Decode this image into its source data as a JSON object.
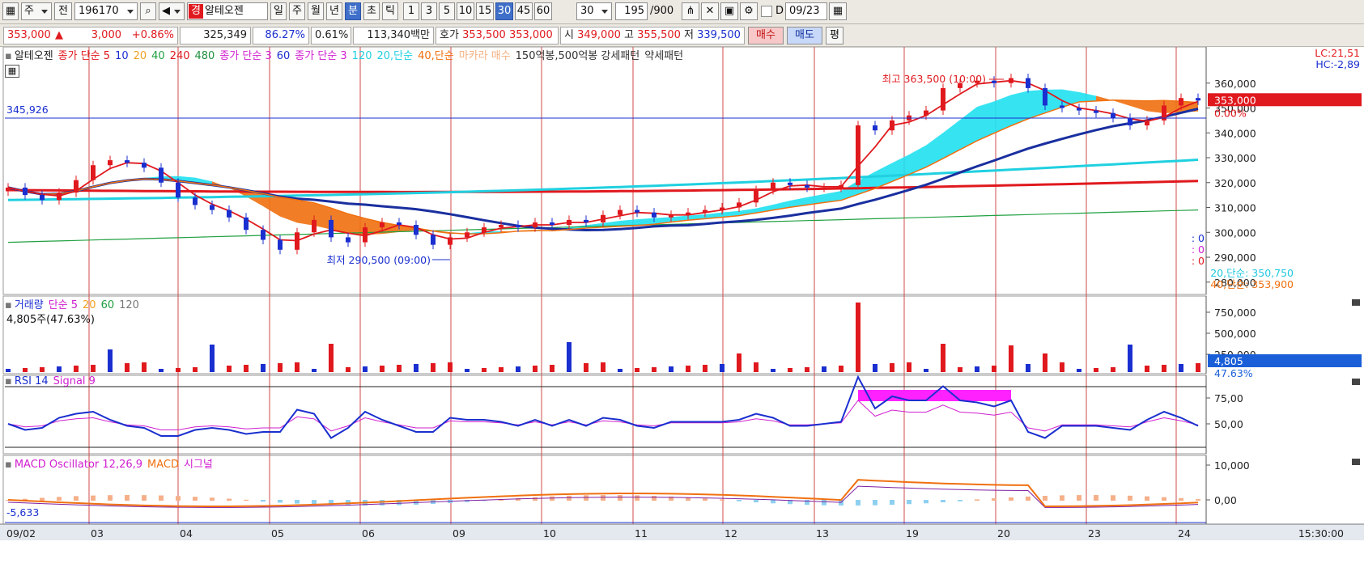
{
  "toolbar": {
    "market": "주",
    "prev": "전",
    "code": "196170",
    "badge": "경",
    "name": "알테오젠",
    "periods": [
      "일",
      "주",
      "월",
      "년",
      "분",
      "초",
      "틱"
    ],
    "selected_period": "분",
    "intervals": [
      "1",
      "3",
      "5",
      "10",
      "15",
      "30",
      "45",
      "60"
    ],
    "selected_interval": "30",
    "interval_value": "30",
    "count": "195",
    "count_max": "/900",
    "checkbox_label": "D",
    "date": "09/23"
  },
  "quote": {
    "price": "353,000",
    "change": "3,000",
    "change_pct": "+0.86%",
    "volume": "325,349",
    "vol_ratio": "86.27%",
    "turnover": "0.61%",
    "amount": "113,340백만",
    "hoga_label": "호가",
    "ask": "353,500",
    "bid": "353,000",
    "open_label": "시",
    "open": "349,000",
    "high_label": "고",
    "high": "355,500",
    "low_label": "저",
    "low": "339,500",
    "buy": "매수",
    "sell": "매도",
    "avg": "평"
  },
  "price_panel": {
    "legend": [
      {
        "text": "알테오젠",
        "color": "#222222"
      },
      {
        "text": "종가 단순 5",
        "color": "#e0191e"
      },
      {
        "text": "10",
        "color": "#1a2fcf"
      },
      {
        "text": "20",
        "color": "#f0a020"
      },
      {
        "text": "40",
        "color": "#20a040"
      },
      {
        "text": "240",
        "color": "#e0191e"
      },
      {
        "text": "480",
        "color": "#209040"
      },
      {
        "text": "종가 단순 3",
        "color": "#d020d0"
      },
      {
        "text": "60",
        "color": "#1a2fcf"
      },
      {
        "text": "종가 단순 3",
        "color": "#d020d0"
      },
      {
        "text": "120",
        "color": "#20d0e0"
      },
      {
        "text": "20,단순",
        "color": "#20d0e0"
      },
      {
        "text": "40,단순",
        "color": "#f07010"
      },
      {
        "text": "마카라 매수",
        "color": "#f5b080"
      },
      {
        "text": "150억봉,500억봉 강세패턴",
        "color": "#333333"
      },
      {
        "text": "약세패턴",
        "color": "#333333"
      }
    ],
    "hline_label": "345,926",
    "max_label": "최고 363,500 (10:00)",
    "min_label": "최저 290,500 (09:00)",
    "lc": "LC:21,51",
    "hc": "HC:-2,89",
    "current_tag": "353,000",
    "pct_tag": "0.00%",
    "ma20_label": "20,단순: 350,750",
    "ma40_label": "40,단순: 353,900",
    "zeros": [
      ": 0",
      ": 0",
      ": 0"
    ]
  },
  "volume_panel": {
    "legend": [
      {
        "text": "거래량",
        "color": "#1a2fcf"
      },
      {
        "text": "단순 5",
        "color": "#d020d0"
      },
      {
        "text": "20",
        "color": "#f0a020"
      },
      {
        "text": "60",
        "color": "#20a040"
      },
      {
        "text": "120",
        "color": "#777777"
      }
    ],
    "info": "4,805주(47.63%)",
    "current_tag": "4,805",
    "pct_tag": "47.63%"
  },
  "rsi_panel": {
    "legend": [
      {
        "text": "RSI 14",
        "color": "#1a2fcf"
      },
      {
        "text": "Signal 9",
        "color": "#d020d0"
      }
    ]
  },
  "macd_panel": {
    "legend": [
      {
        "text": "MACD Oscillator 12,26,9",
        "color": "#d020d0"
      },
      {
        "text": "MACD",
        "color": "#f07010"
      },
      {
        "text": "시그널",
        "color": "#d020d0"
      }
    ],
    "value_label": "-5,633"
  },
  "time_axis": {
    "dates": [
      "09/02",
      "03",
      "04",
      "05",
      "06",
      "09",
      "10",
      "11",
      "12",
      "13",
      "19",
      "20",
      "23",
      "24"
    ],
    "clock": "15:30:00"
  },
  "chart_data": {
    "type": "candlestick",
    "price_axis": {
      "ticks": [
        360000,
        350000,
        340000,
        330000,
        320000,
        310000,
        300000,
        290000,
        280000
      ],
      "labels": [
        "360,000",
        "350,000",
        "340,000",
        "330,000",
        "320,000",
        "310,000",
        "300,000",
        "290,000",
        "280,000"
      ],
      "ylim": [
        277000,
        370000
      ]
    },
    "volume_axis": {
      "labels": [
        "750,000",
        "500,000",
        "250,000"
      ]
    },
    "rsi_axis": {
      "labels": [
        "75,00",
        "50,00"
      ]
    },
    "macd_axis": {
      "labels": [
        "10,000",
        "0,00"
      ]
    },
    "close": [
      318000,
      315000,
      313000,
      316000,
      321000,
      327000,
      329000,
      328000,
      326000,
      320000,
      314000,
      311000,
      309000,
      306000,
      301000,
      297000,
      293000,
      300000,
      305000,
      298000,
      296000,
      302000,
      304000,
      303000,
      299000,
      295000,
      298000,
      300000,
      302000,
      303000,
      302000,
      304000,
      303000,
      305000,
      304000,
      307000,
      309000,
      308000,
      306000,
      307000,
      308000,
      309000,
      310000,
      312000,
      317000,
      320000,
      319000,
      318000,
      318000,
      319000,
      343000,
      341000,
      345000,
      347000,
      349000,
      358000,
      360000,
      361000,
      360000,
      362000,
      358000,
      351000,
      350000,
      349000,
      348000,
      346000,
      343000,
      345000,
      351000,
      354000,
      353000
    ]
  },
  "colors": {
    "up": "#e0191e",
    "down": "#1a2fcf",
    "ma5": "#e0191e",
    "ma60": "#1a2fcf",
    "ma120": "#20d0e0",
    "ma240": "#e0191e",
    "ma480": "#20a040",
    "cloud_up": "#20e0f0",
    "cloud_down": "#f07010",
    "grid_v": "#d24b4b",
    "hline": "#1a2fcf"
  }
}
